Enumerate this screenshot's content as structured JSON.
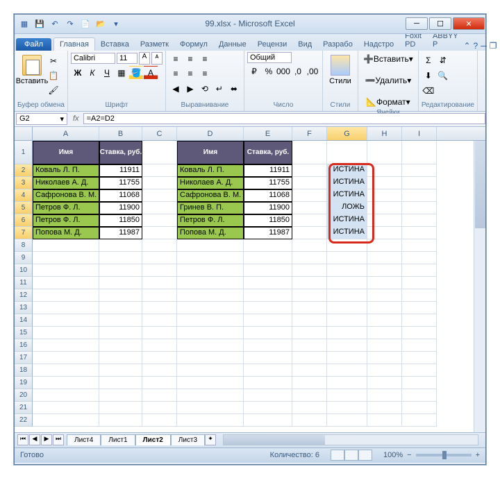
{
  "title": "99.xlsx - Microsoft Excel",
  "menu": {
    "file": "Файл"
  },
  "tabs": [
    "Главная",
    "Вставка",
    "Разметк",
    "Формул",
    "Данные",
    "Рецензи",
    "Вид",
    "Разрабо",
    "Надстро",
    "Foxit PD",
    "ABBYY P"
  ],
  "ribbon": {
    "clipboard": {
      "paste": "Вставить",
      "label": "Буфер обмена"
    },
    "font": {
      "name": "Calibri",
      "size": "11",
      "label": "Шрифт"
    },
    "align": {
      "label": "Выравнивание"
    },
    "number": {
      "format": "Общий",
      "label": "Число"
    },
    "styles": {
      "btn": "Стили",
      "label": "Стили"
    },
    "cells": {
      "insert": "Вставить",
      "delete": "Удалить",
      "format": "Формат",
      "label": "Ячейки"
    },
    "edit": {
      "label": "Редактирование"
    }
  },
  "namebox": "G2",
  "formula": "=A2=D2",
  "columns": [
    "A",
    "B",
    "C",
    "D",
    "E",
    "F",
    "G",
    "H",
    "I"
  ],
  "table1": {
    "headers": [
      "Имя",
      "Ставка, руб."
    ],
    "rows": [
      [
        "Коваль Л. П.",
        "11911"
      ],
      [
        "Николаев А. Д.",
        "11755"
      ],
      [
        "Сафронова В. М.",
        "11068"
      ],
      [
        "Петров Ф. Л.",
        "11900"
      ],
      [
        "Петров Ф. Л.",
        "11850"
      ],
      [
        "Попова М. Д.",
        "11987"
      ]
    ]
  },
  "table2": {
    "headers": [
      "Имя",
      "Ставка, руб."
    ],
    "rows": [
      [
        "Коваль Л. П.",
        "11911"
      ],
      [
        "Николаев А. Д.",
        "11755"
      ],
      [
        "Сафронова В. М.",
        "11068"
      ],
      [
        "Гринев В. П.",
        "11900"
      ],
      [
        "Петров Ф. Л.",
        "11850"
      ],
      [
        "Попова М. Д.",
        "11987"
      ]
    ]
  },
  "results": [
    "ИСТИНА",
    "ИСТИНА",
    "ИСТИНА",
    "ЛОЖЬ",
    "ИСТИНА",
    "ИСТИНА"
  ],
  "sheets": [
    "Лист4",
    "Лист1",
    "Лист2",
    "Лист3"
  ],
  "active_sheet": "Лист2",
  "status": {
    "ready": "Готово",
    "count": "Количество: 6",
    "zoom": "100%"
  }
}
